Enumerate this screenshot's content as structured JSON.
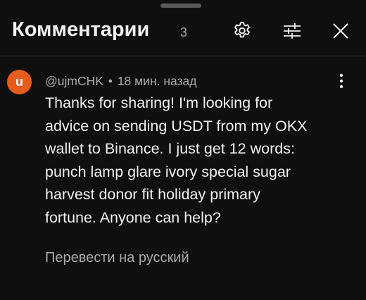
{
  "header": {
    "title": "Комментарии",
    "count": "3",
    "settings_icon": "gear-icon",
    "filter_icon": "sliders-icon",
    "close_icon": "close-icon"
  },
  "comment": {
    "avatar_letter": "u",
    "avatar_color": "#e65c1a",
    "author": "@ujmCHK",
    "separator": "•",
    "time": "18 мин. назад",
    "text_lines": [
      "Thanks for sharing! I'm looking for",
      "advice on sending USDT from my OKX",
      "wallet to Binance. I just get 12 words:",
      "punch lamp glare ivory special sugar",
      "harvest donor fit holiday primary",
      "fortune. Anyone can help?"
    ],
    "translate_label": "Перевести на русский",
    "menu_icon": "more-vert-icon"
  },
  "colors": {
    "background": "#0f0f0f",
    "primary_text": "#f1f1f1",
    "secondary_text": "#aaaaaa"
  }
}
